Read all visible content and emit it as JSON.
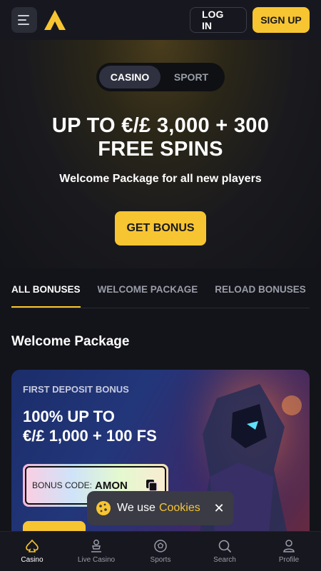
{
  "header": {
    "login_label": "LOG IN",
    "signup_label": "SIGN UP"
  },
  "hero": {
    "toggle": [
      "CASINO",
      "SPORT"
    ],
    "title_line1": "UP TO €/£ 3,000 + 300",
    "title_line2": "FREE SPINS",
    "subtitle": "Welcome Package for all new players",
    "cta": "GET BONUS"
  },
  "bonus_tabs": [
    "ALL BONUSES",
    "WELCOME PACKAGE",
    "RELOAD BONUSES"
  ],
  "section_title": "Welcome Package",
  "card": {
    "label": "FIRST DEPOSIT BONUS",
    "title_line1": "100% UP TO",
    "title_line2": "€/£ 1,000 + 100 FS",
    "code_label": "BONUS CODE:",
    "code_value": "AMON"
  },
  "cookie": {
    "text": "We use",
    "link": "Cookies"
  },
  "bottom_nav": [
    "Casino",
    "Live Casino",
    "Sports",
    "Search",
    "Profile"
  ],
  "colors": {
    "accent": "#f7c531",
    "background": "#131419",
    "header": "#17181f"
  }
}
